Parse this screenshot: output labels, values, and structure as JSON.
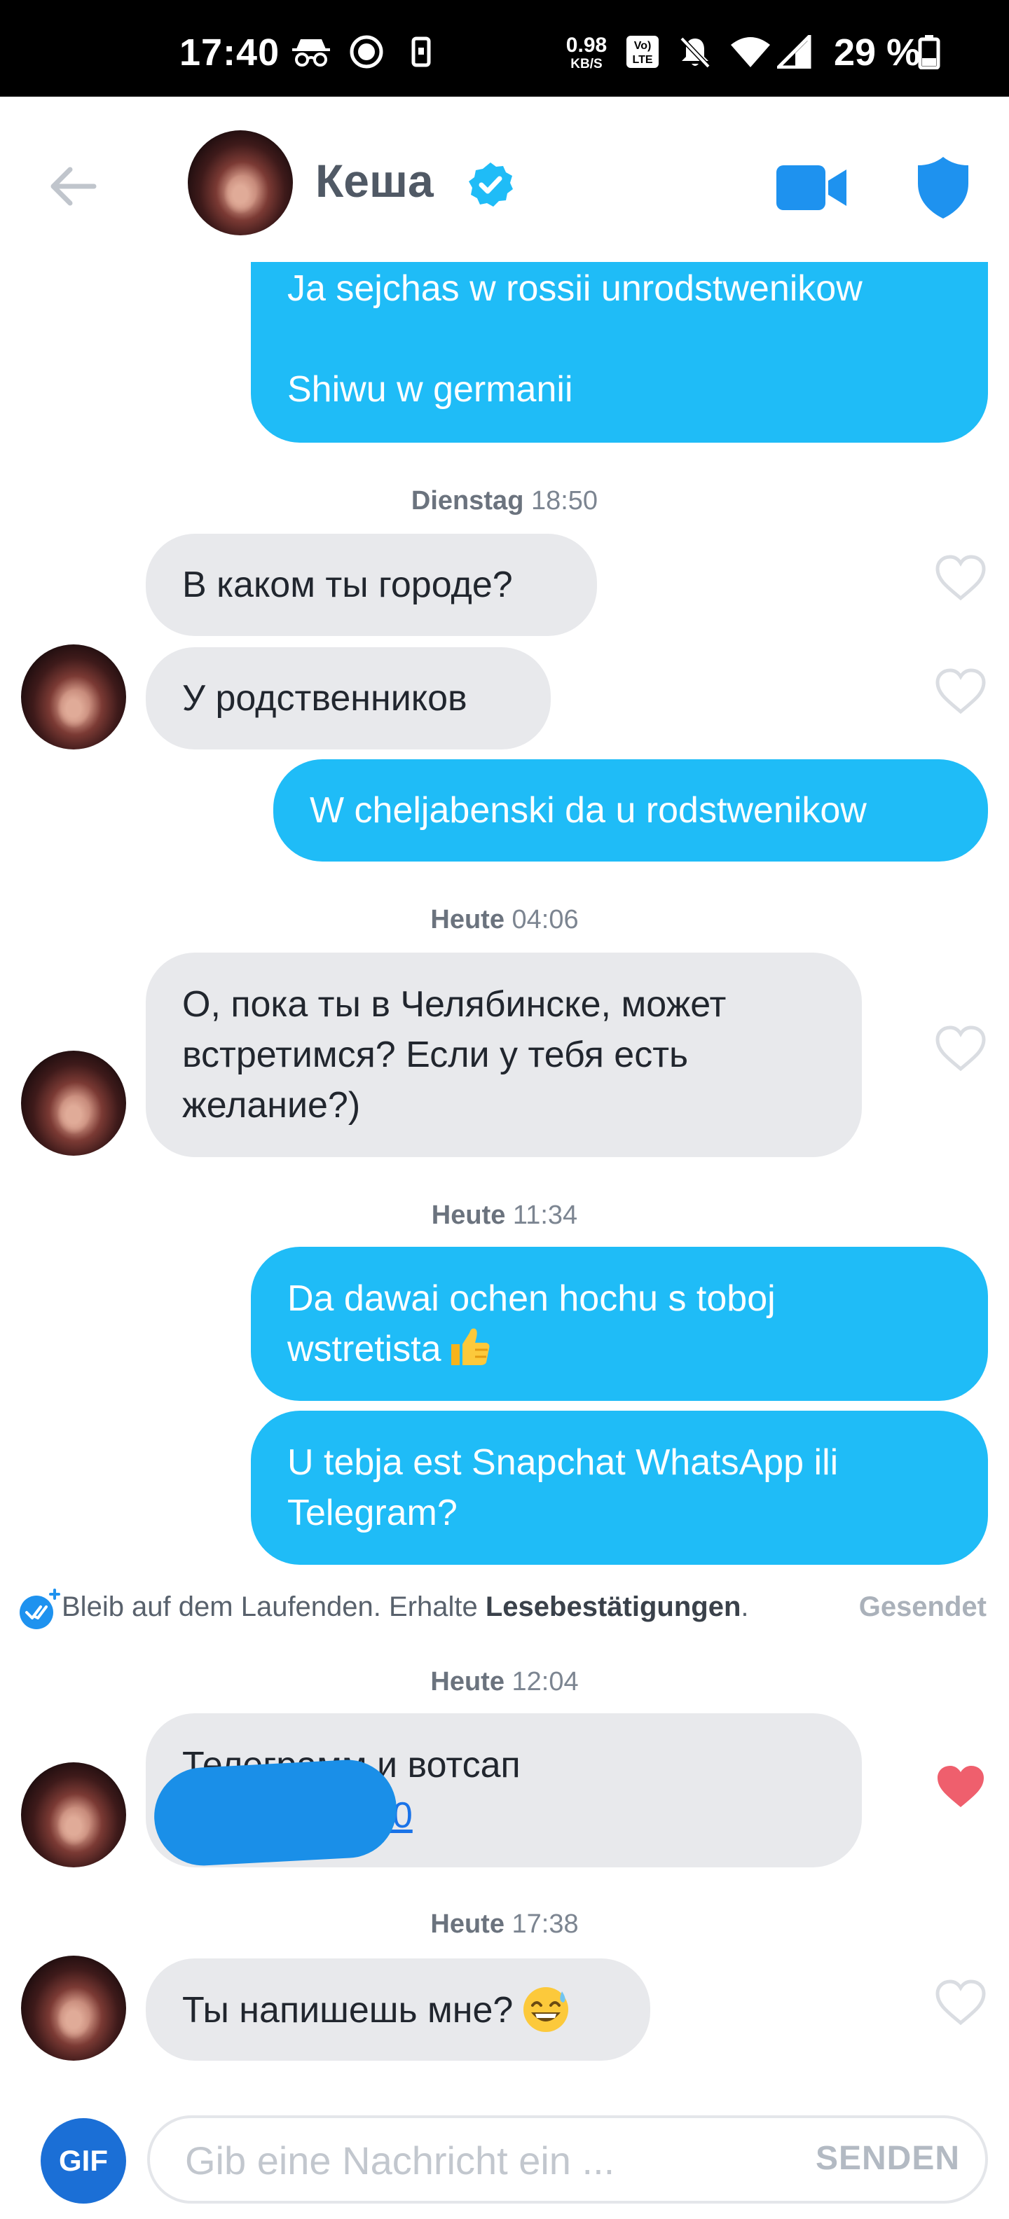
{
  "status_bar": {
    "time": "17:40",
    "net_speed_value": "0.98",
    "net_speed_unit": "KB/S",
    "network_badge_top": "Vo)",
    "network_badge_bottom": "LTE",
    "battery": "29 %"
  },
  "header": {
    "name": "Кеша",
    "accent_color": "#1fbcf7"
  },
  "messages": {
    "m1_line1": "Ja sejchas w rossii unrodstwenikow",
    "m1_line2": "Shiwu w germanii",
    "stamp1_day": "Dienstag",
    "stamp1_time": "18:50",
    "m2": "В каком ты городе?",
    "m3": "У родственников",
    "m4": "W cheljabenski da u rodstwenikow",
    "stamp2_day": "Heute",
    "stamp2_time": "04:06",
    "m5_line1": "О, пока ты в Челябинске, может",
    "m5_line2": "встретимся? Если у тебя есть",
    "m5_line3": "желание?)",
    "stamp3_day": "Heute",
    "stamp3_time": "11:34",
    "m6_line1": "Da dawai ochen hochu s toboj",
    "m6_line2": "wstretista",
    "m7_line1": "U tebja est Snapchat WhatsApp ili",
    "m7_line2": "Telegram?",
    "stamp4_day": "Heute",
    "stamp4_time": "12:04",
    "m8_line1": "Телеграмм и вотсап",
    "m8_link": "700",
    "stamp5_day": "Heute",
    "stamp5_time": "17:38",
    "m9": "Ты напишешь мне?"
  },
  "receipts": {
    "text": "Bleib auf dem Laufenden. Erhalte ",
    "link": "Lesebestätigungen",
    "period": ".",
    "status": "Gesendet"
  },
  "composer": {
    "gif_label": "GIF",
    "placeholder": "Gib eine Nachricht ein ...",
    "send_label": "SENDEN"
  },
  "icons": {
    "liked_heart_color": "#ef5f6d",
    "empty_heart_color": "#dadde2"
  }
}
